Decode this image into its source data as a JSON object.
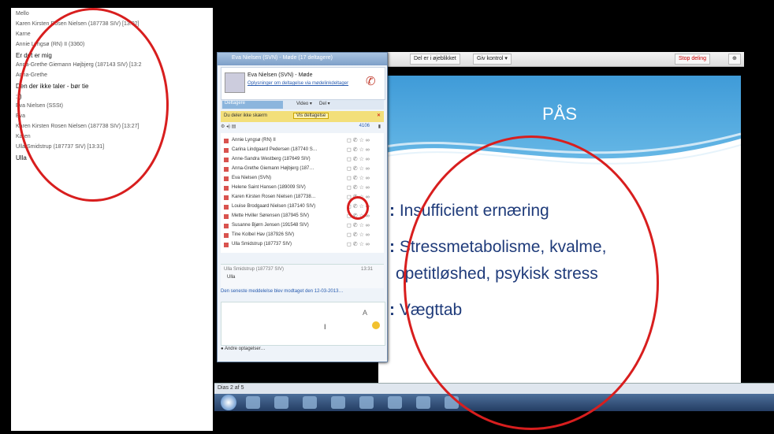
{
  "chat_log": {
    "rows": [
      {
        "text": "Mello",
        "kind": "who"
      },
      {
        "text": "Karen Kirsten Rosen Nielsen (187738 SIV) [13:02]",
        "kind": "who"
      },
      {
        "text": "Karne",
        "kind": "who"
      },
      {
        "text": "Annie Lyngsø (RN) II (3360)",
        "kind": "who"
      },
      {
        "text": "Er det er mig",
        "kind": "msg"
      },
      {
        "text": "Anna-Grethe Giemann Højbjerg (187143 SIV) [13:2",
        "kind": "who"
      },
      {
        "text": "Anna-Grethe",
        "kind": "who"
      },
      {
        "text": "Den der ikke taler - bør tie",
        "kind": "msg"
      },
      {
        "text": ":-)",
        "kind": "msg"
      },
      {
        "text": "Eva Nielsen (SSSt)",
        "kind": "who"
      },
      {
        "text": "Eva",
        "kind": "who"
      },
      {
        "text": "Karen Kirsten Rosen Nielsen (187738 SIV) [13:27]",
        "kind": "who"
      },
      {
        "text": "Karen",
        "kind": "who"
      },
      {
        "text": "Ulla Smidstrup (187737 SIV) [13:31]",
        "kind": "who"
      },
      {
        "text": "Ulla",
        "kind": "msg"
      }
    ]
  },
  "topbar": {
    "share_label": "Del er i øjeblikket",
    "control_label": "Giv kontrol ▾",
    "stop_label": "Stop deling",
    "pin": "⊕"
  },
  "slide": {
    "title": "PÅS",
    "bullets": [
      {
        "marker": ":",
        "text": "Insufficient ernæring"
      },
      {
        "marker": ":",
        "text": "Stressmetabolisme, kvalme,"
      },
      {
        "marker": "",
        "text": "opetitløshed, psykisk stress"
      },
      {
        "marker": ":",
        "text": "Vægttab"
      }
    ],
    "footer": "Dias 2 af 5"
  },
  "lync": {
    "title": "Eva Nielsen (SVN) - Møde (17 deltagere)",
    "contact_name": "Eva Nielsen (SVN) - Møde",
    "contact_link": "Oplysninger om deltagelse via mødelinkdeltager",
    "tab_active": "Deltagere",
    "tab_2": "Video ▾",
    "tab_3": "Del ▾",
    "notice_text": "Du deler ikke skærm",
    "notice_button": "Vis deltagelse",
    "toolbar_count": "4106",
    "participants": [
      "Annie Lyngsø (RN) II",
      "Carina Lindgaard Pedersen (187740 S…",
      "Anne-Sandra Westberg (187649 SIV)",
      "Anna-Grethe Giemann Højbjerg (187…",
      "Eva Nielsen (SVN)",
      "Helene Saint Hansen (189009 SIV)",
      "Karen Kirsten Rosen Nielsen (187738…",
      "Louise Brodgaard Nielsen (187140 SIV)",
      "Mette Hviller Sørensen (187945 SIV)",
      "Susanne Bjørn Jensen (191548 SIV)",
      "Tine Kolbel Hav (187926 SIV)",
      "Ulla Smidstrup (187737 SIV)"
    ],
    "last_author": "Ulla Smidstrup (187737 SIV)",
    "last_text": "Ulla",
    "last_time": "13:31",
    "old_messages": "Den seneste meddelelse blev modtaget den 12-03-2013…",
    "compose_font": "A",
    "compose_cursor": "I",
    "options_label": "Andre optagelser…"
  },
  "colors": {
    "annotation_circle": "#d81e1e",
    "slide_text": "#1f3b7a",
    "slide_header": "#3f9bd8"
  }
}
